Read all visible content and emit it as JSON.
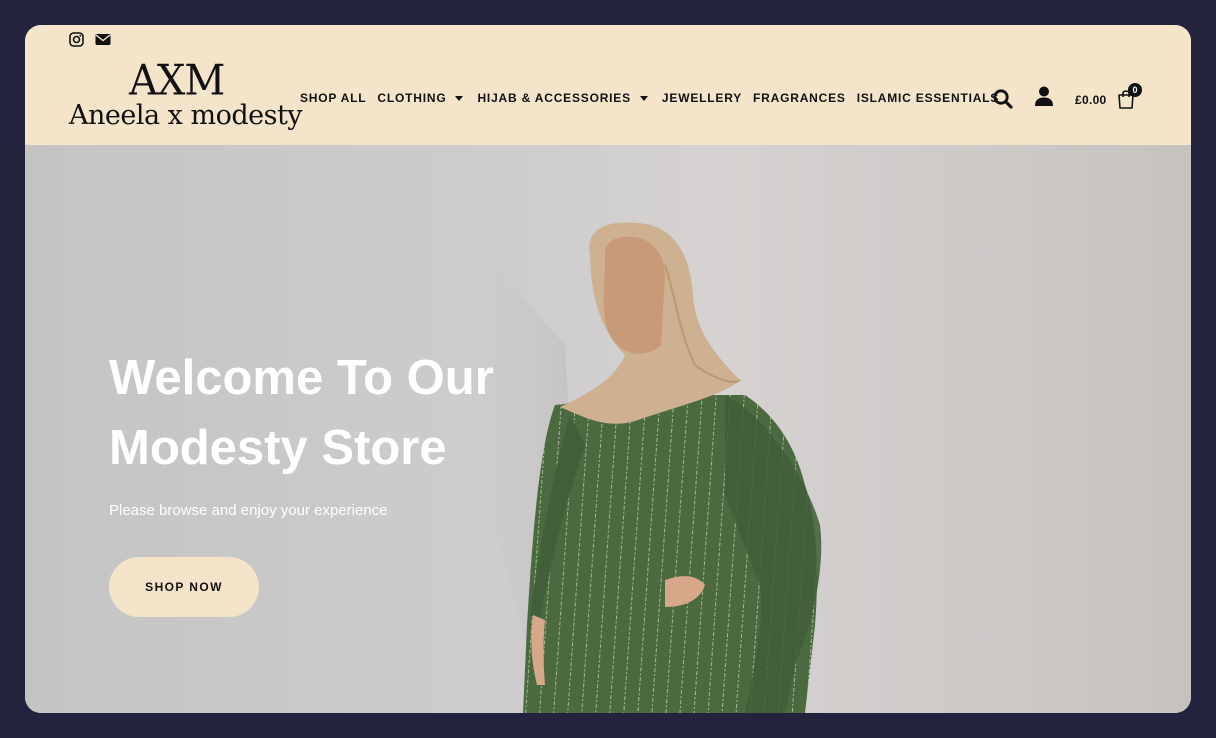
{
  "header": {
    "social": [
      {
        "name": "instagram-icon"
      },
      {
        "name": "email-icon"
      }
    ],
    "logo": {
      "monogram": "AXM",
      "wordmark": "Aneela x modesty"
    },
    "nav": [
      {
        "label": "SHOP ALL",
        "dropdown": false
      },
      {
        "label": "CLOTHING",
        "dropdown": true
      },
      {
        "label": "HIJAB & ACCESSORIES",
        "dropdown": true
      },
      {
        "label": "JEWELLERY",
        "dropdown": false
      },
      {
        "label": "FRAGRANCES",
        "dropdown": false
      },
      {
        "label": "ISLAMIC ESSENTIALS",
        "dropdown": false
      }
    ],
    "cart": {
      "total": "£0.00",
      "count": "0"
    }
  },
  "hero": {
    "title_line1": "Welcome To Our",
    "title_line2": "Modesty Store",
    "subtitle": "Please browse and enjoy your experience",
    "cta": "SHOP NOW"
  },
  "colors": {
    "header_bg": "#f4e4ca",
    "frame_bg": "#23233d",
    "button_bg": "#f3e3c8",
    "dress_green": "#4a6a40",
    "hijab_beige": "#cdb191"
  }
}
